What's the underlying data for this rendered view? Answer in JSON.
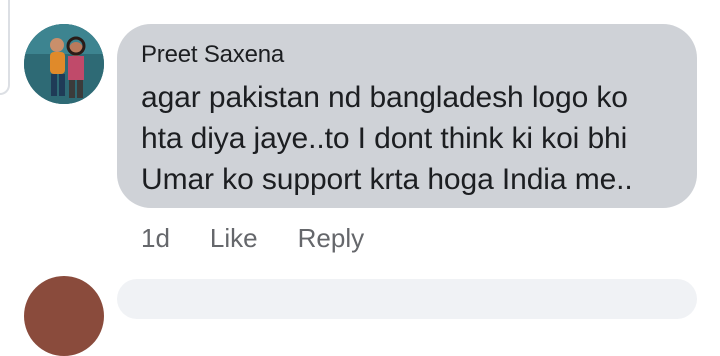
{
  "comment": {
    "author": "Preet Saxena",
    "text": "agar pakistan nd bangladesh logo ko\nhta diya jaye..to I dont think ki koi bhi\nUmar ko support krta hoga India me..",
    "timestamp": "1d",
    "like_label": "Like",
    "reply_label": "Reply"
  },
  "colors": {
    "bubble_bg": "#cfd2d7",
    "text": "#1c1e21",
    "secondary_text": "#65676b"
  }
}
